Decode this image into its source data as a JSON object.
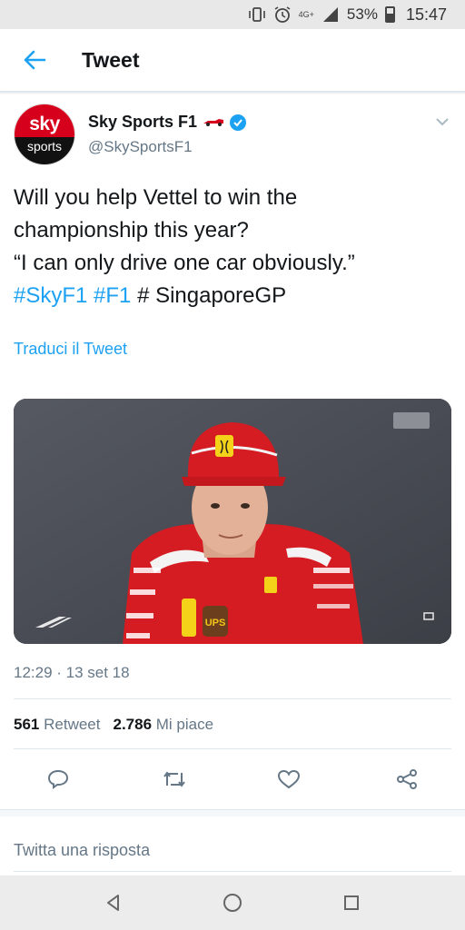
{
  "status_bar": {
    "network": "4G+",
    "battery": "53%",
    "time": "15:47"
  },
  "header": {
    "title": "Tweet"
  },
  "tweet": {
    "author_name": "Sky Sports F1",
    "author_handle": "@SkySportsF1",
    "avatar_top": "sky",
    "avatar_bottom": "sports",
    "text_line1": "Will you help Vettel to win the",
    "text_line2": "championship this year?",
    "text_line3": "“I can only drive one car obviously.”",
    "hashtag1": "#SkyF1",
    "hashtag2": "#F1",
    "text_tail": "# SingaporeGP",
    "translate": "Traduci il Tweet",
    "timestamp": "12:29 · 13 set 18",
    "retweet_count": "561",
    "retweet_label": "Retweet",
    "like_count": "2.786",
    "like_label": "Mi piace"
  },
  "reply": {
    "placeholder": "Twitta una risposta"
  },
  "colors": {
    "accent": "#1da1f2",
    "text": "#14171a",
    "muted": "#657786",
    "divider": "#e1e8ed"
  },
  "media": {
    "cap_text": "UPS"
  }
}
